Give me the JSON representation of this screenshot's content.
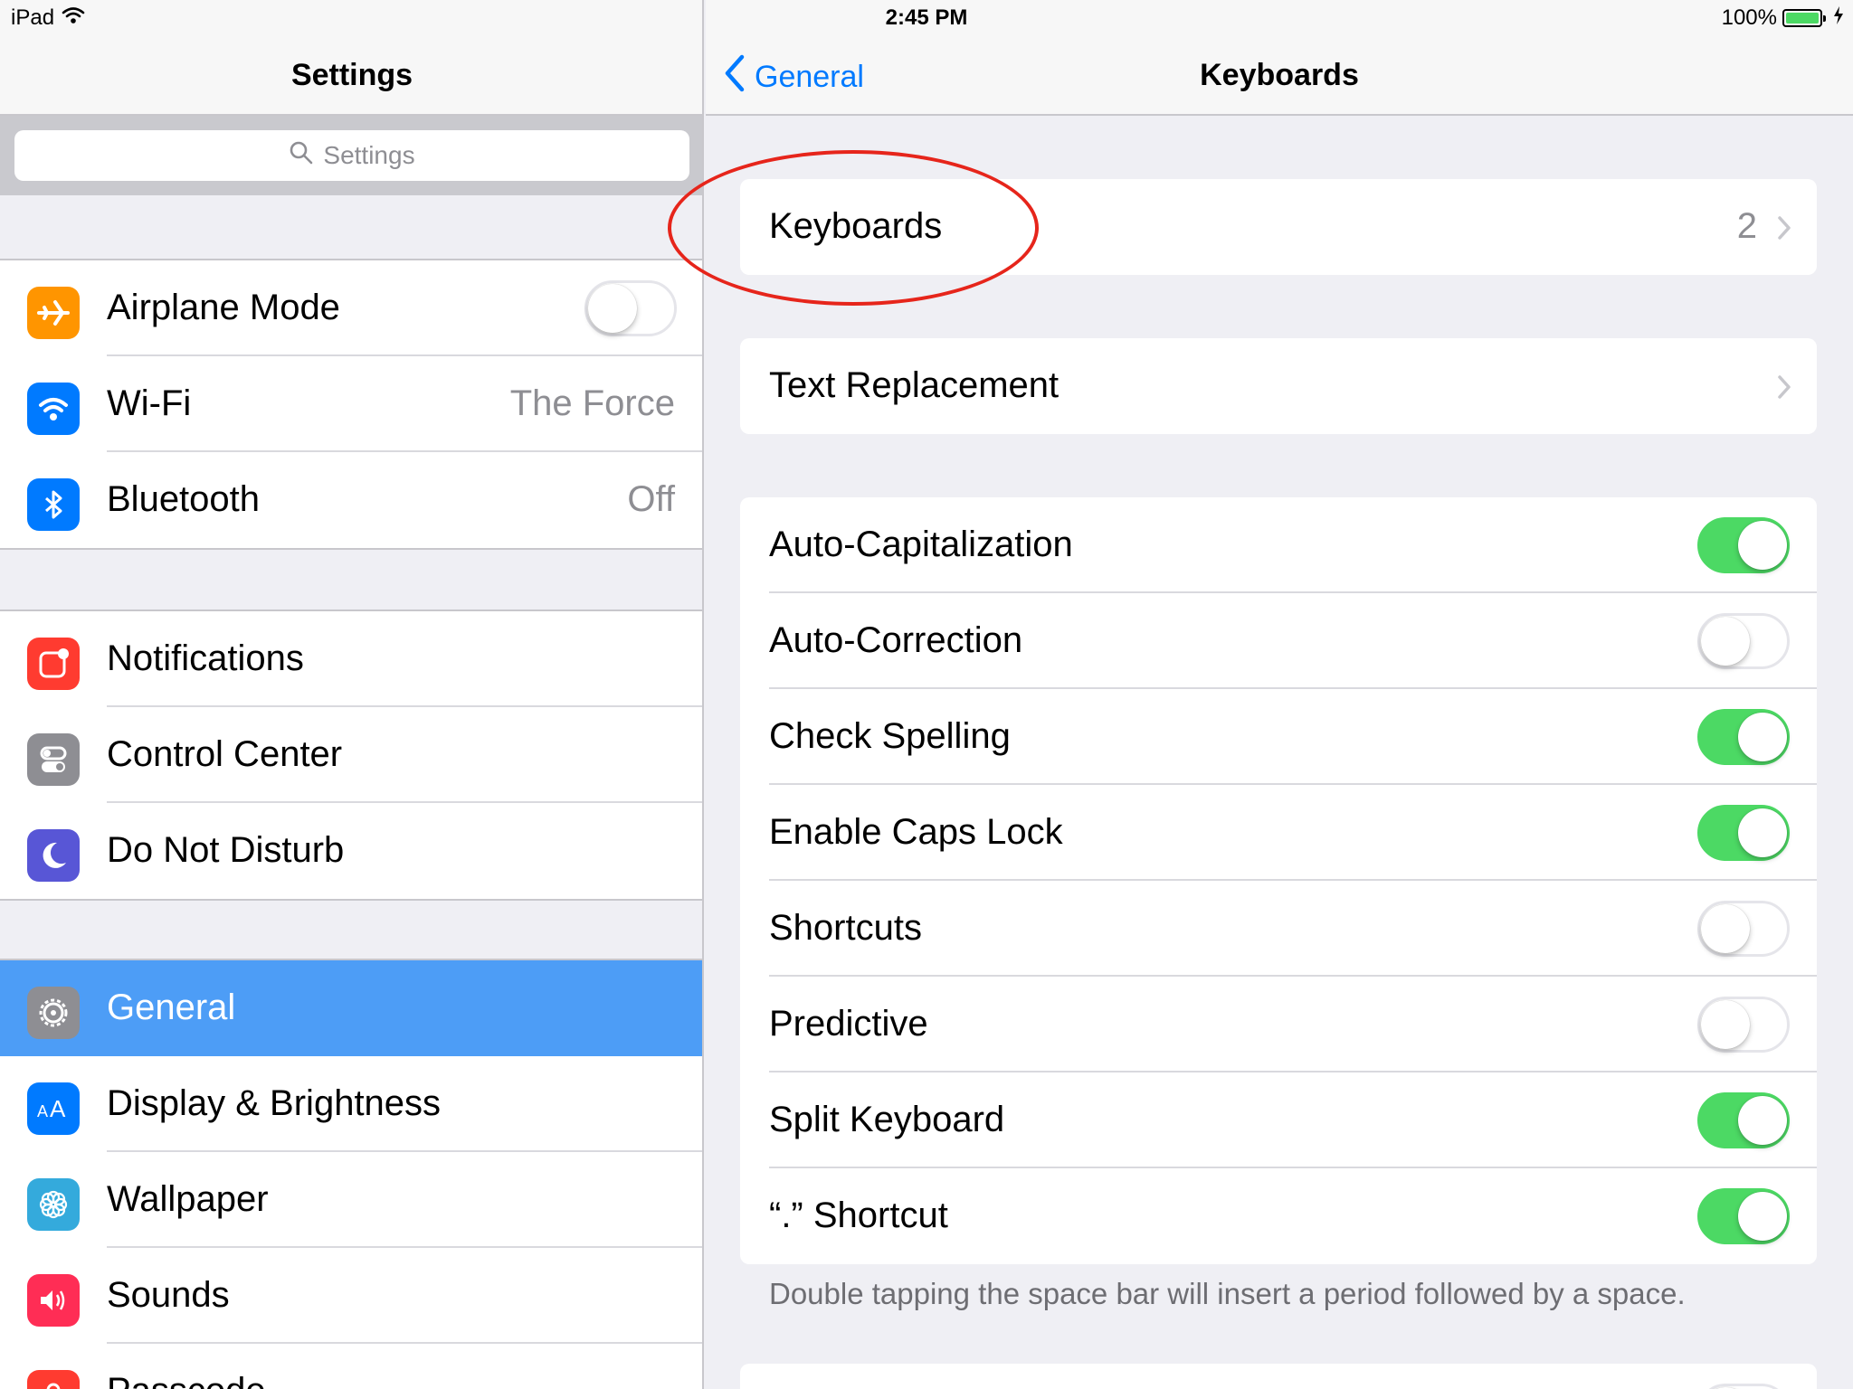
{
  "status_bar": {
    "device": "iPad",
    "time": "2:45 PM",
    "battery": "100%",
    "battery_level": 1.0
  },
  "left_pane": {
    "title": "Settings",
    "search_placeholder": "Settings",
    "groups": [
      [
        {
          "label": "Airplane Mode",
          "icon": "airplane-icon",
          "color": "#ff9500",
          "toggle": false
        },
        {
          "label": "Wi-Fi",
          "icon": "wifi-icon",
          "color": "#007aff",
          "value": "The Force"
        },
        {
          "label": "Bluetooth",
          "icon": "bluetooth-icon",
          "color": "#007aff",
          "value": "Off"
        }
      ],
      [
        {
          "label": "Notifications",
          "icon": "notifications-icon",
          "color": "#ff3b30"
        },
        {
          "label": "Control Center",
          "icon": "control-center-icon",
          "color": "#8e8e93"
        },
        {
          "label": "Do Not Disturb",
          "icon": "moon-icon",
          "color": "#5856d6"
        }
      ],
      [
        {
          "label": "General",
          "icon": "gear-icon",
          "color": "#8e8e93",
          "selected": true
        },
        {
          "label": "Display & Brightness",
          "icon": "display-icon",
          "color": "#007aff"
        },
        {
          "label": "Wallpaper",
          "icon": "wallpaper-icon",
          "color": "#34aadc"
        },
        {
          "label": "Sounds",
          "icon": "speaker-icon",
          "color": "#ff2d55"
        },
        {
          "label": "Passcode",
          "icon": "lock-icon",
          "color": "#ff3b30"
        }
      ]
    ]
  },
  "right_pane": {
    "back_label": "General",
    "title": "Keyboards",
    "keyboards": {
      "label": "Keyboards",
      "value": "2"
    },
    "text_replacement": {
      "label": "Text Replacement"
    },
    "toggles": [
      {
        "label": "Auto-Capitalization",
        "on": true
      },
      {
        "label": "Auto-Correction",
        "on": false
      },
      {
        "label": "Check Spelling",
        "on": true
      },
      {
        "label": "Enable Caps Lock",
        "on": true
      },
      {
        "label": "Shortcuts",
        "on": false
      },
      {
        "label": "Predictive",
        "on": false
      },
      {
        "label": "Split Keyboard",
        "on": true
      },
      {
        "label": "“.” Shortcut",
        "on": true
      }
    ],
    "footer": "Double tapping the space bar will insert a period followed by a space."
  },
  "colors": {
    "accent": "#007aff",
    "toggle_on": "#4cd964",
    "selected_row": "#4d9df6",
    "annotation": "#e6251b"
  }
}
